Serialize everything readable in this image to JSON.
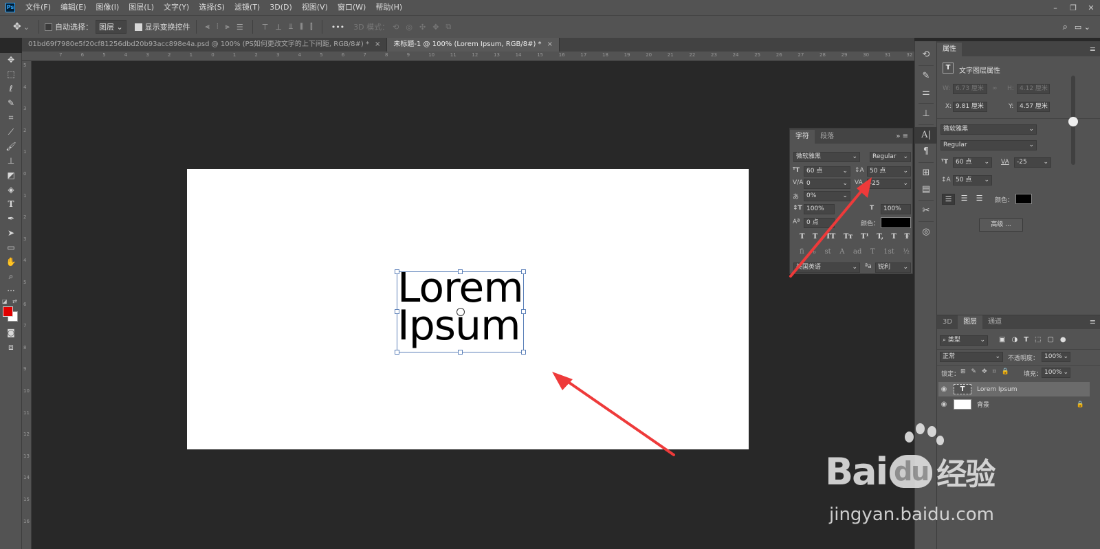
{
  "menubar": {
    "logo": "Ps",
    "items": [
      "文件(F)",
      "编辑(E)",
      "图像(I)",
      "图层(L)",
      "文字(Y)",
      "选择(S)",
      "滤镜(T)",
      "3D(D)",
      "视图(V)",
      "窗口(W)",
      "帮助(H)"
    ],
    "window_controls": [
      "–",
      "❐",
      "✕"
    ]
  },
  "optionsbar": {
    "auto_select_label": "自动选择：",
    "auto_select_value": "图层",
    "show_transform_label": "显示变换控件",
    "mode_3d_label": "3D 模式："
  },
  "tabs": [
    {
      "label": "01bd69f7980e5f20cf81256dbd20b93acc898e4a.psd @ 100% (PS如何更改文字的上下间距, RGB/8#) *",
      "close": "×"
    },
    {
      "label": "未标题-1 @ 100% (Lorem Ipsum, RGB/8#) *",
      "close": "×"
    }
  ],
  "ruler": {
    "top_ticks": [
      "7",
      "6",
      "5",
      "4",
      "3",
      "2",
      "1",
      "0",
      "1",
      "2",
      "3",
      "4",
      "5",
      "6",
      "7",
      "8",
      "9",
      "10",
      "11",
      "12",
      "13",
      "14",
      "15",
      "16",
      "17",
      "18",
      "19",
      "20",
      "21",
      "22",
      "23",
      "24",
      "25",
      "26",
      "27",
      "28",
      "29",
      "30",
      "31",
      "32",
      "33"
    ],
    "left_ticks": [
      "5",
      "4",
      "3",
      "2",
      "1",
      "0",
      "1",
      "2",
      "3",
      "4",
      "5",
      "6",
      "7",
      "8",
      "9",
      "10",
      "11",
      "12",
      "13",
      "14",
      "15",
      "16"
    ]
  },
  "document": {
    "text_line1": "Lorem",
    "text_line2": "Ipsum"
  },
  "character_panel": {
    "tab_character": "字符",
    "tab_paragraph": "段落",
    "font_family": "微软雅黑",
    "font_style": "Regular",
    "font_size": "60 点",
    "leading": "50 点",
    "kerning": "0",
    "tracking": "-25",
    "scale_tsume": "0%",
    "vertical_scale": "100%",
    "horizontal_scale": "100%",
    "baseline_shift": "0 点",
    "color_label": "颜色：",
    "language": "美国英语",
    "antialias": "锐利",
    "type_styles": [
      "T",
      "T",
      "TT",
      "Tт",
      "T¹",
      "T,",
      "T",
      "Ŧ"
    ],
    "opentype": [
      "fi",
      "ℴ",
      "st",
      "A",
      "ad",
      "T",
      "1st",
      "½"
    ],
    "aa_label": "ªa"
  },
  "properties_panel": {
    "title": "属性",
    "subtitle": "文字图层属性",
    "w_label": "W:",
    "w_value": "6.73 厘米",
    "h_label": "H:",
    "h_value": "4.12 厘米",
    "x_label": "X:",
    "x_value": "9.81 厘米",
    "y_label": "Y:",
    "y_value": "4.57 厘米",
    "font_family": "微软雅黑",
    "font_style": "Regular",
    "font_size": "60 点",
    "tracking": "-25",
    "leading": "50 点",
    "color_label": "颜色：",
    "advanced_button": "高级 ..."
  },
  "layers_panel": {
    "tabs": [
      "3D",
      "图层",
      "通道"
    ],
    "filter_kind": "类型",
    "blend_mode": "正常",
    "opacity_label": "不透明度：",
    "opacity_value": "100%",
    "lock_label": "锁定：",
    "fill_label": "填充：",
    "fill_value": "100%",
    "layers": [
      {
        "name": "Lorem  Ipsum",
        "type": "text",
        "selected": true
      },
      {
        "name": "背景",
        "type": "pixel",
        "selected": false,
        "locked": true
      }
    ]
  },
  "watermark": {
    "brand": "Bai",
    "brand_du": "du",
    "product": "经验",
    "url": "jingyan.baidu.com"
  },
  "colors": {
    "foreground": "#e00000",
    "background": "#ffffff",
    "text_color": "#000000",
    "arrow": "#ee3a3a"
  }
}
